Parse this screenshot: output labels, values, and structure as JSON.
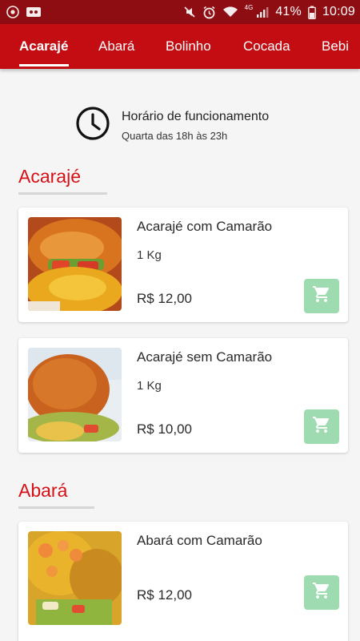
{
  "status_bar": {
    "network": "4G",
    "battery": "41%",
    "time": "10:09",
    "icons": [
      "chrome-icon",
      "voicemail-icon",
      "mute-icon",
      "alarm-icon",
      "wifi-icon",
      "signal-icon",
      "battery-icon"
    ]
  },
  "tabs": [
    {
      "label": "Acarajé",
      "active": true
    },
    {
      "label": "Abará",
      "active": false
    },
    {
      "label": "Bolinho",
      "active": false
    },
    {
      "label": "Cocada",
      "active": false
    },
    {
      "label": "Bebi",
      "active": false
    }
  ],
  "opening_hours": {
    "title": "Horário de funcionamento",
    "schedule": "Quarta das 18h às 23h",
    "icon": "clock-icon"
  },
  "sections": [
    {
      "title": "Acarajé",
      "items": [
        {
          "name": "Acarajé com Camarão",
          "weight": "1 Kg",
          "price": "R$ 12,00"
        },
        {
          "name": "Acarajé sem Camarão",
          "weight": "1 Kg",
          "price": "R$ 10,00"
        }
      ]
    },
    {
      "title": "Abará",
      "items": [
        {
          "name": "Abará com Camarão",
          "price": "R$ 12,00"
        }
      ]
    }
  ],
  "colors": {
    "status_bar": "#8e0d12",
    "tab_bar": "#c30d12",
    "section_title": "#d71016",
    "cart_button": "#9fdbb0"
  }
}
